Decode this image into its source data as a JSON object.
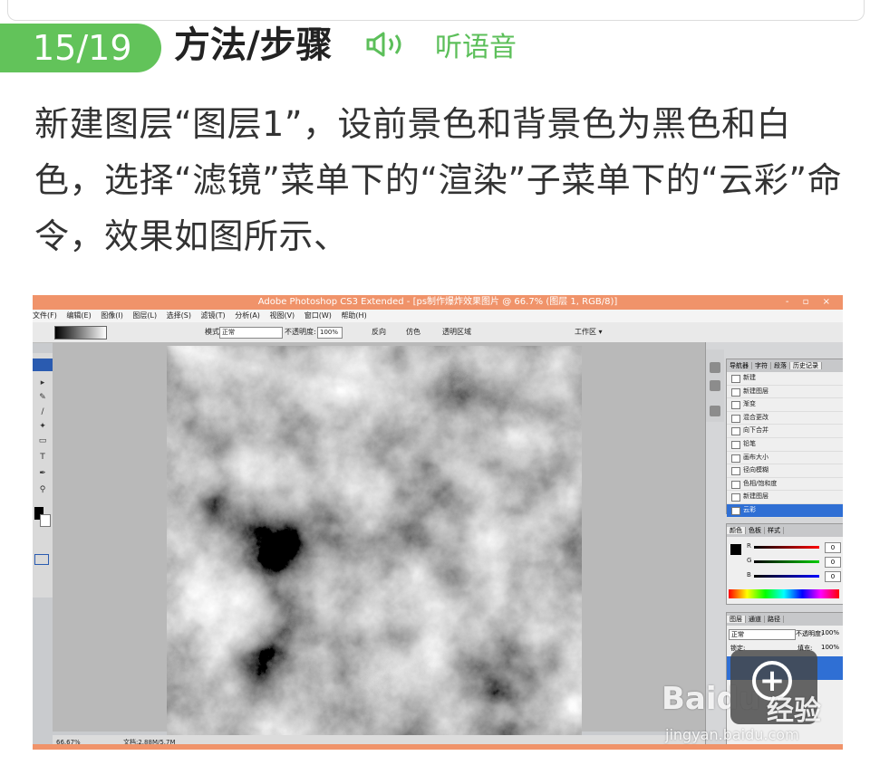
{
  "step": {
    "label": "15/19"
  },
  "header": {
    "title": "方法/步骤",
    "listen_label": "听语音",
    "speaker_icon": "speaker-icon",
    "accent": "#62c35a"
  },
  "body": {
    "text": "新建图层“图层1”，设前景色和背景色为黑色和白色，选择“滤镜”菜单下的“渲染”子菜单下的“云彩”命令，效果如图所示、"
  },
  "screenshot": {
    "window_title": "Adobe Photoshop CS3 Extended - [ps制作爆炸效果图片 @ 66.7% (图层 1, RGB/8)]",
    "window_buttons": "- ▫ ×",
    "menu": [
      "文件(F)",
      "编辑(E)",
      "图像(I)",
      "图层(L)",
      "选择(S)",
      "滤镜(T)",
      "分析(A)",
      "视图(V)",
      "窗口(W)",
      "帮助(H)"
    ],
    "options": {
      "mode_label": "模式:",
      "mode_value": "正常",
      "opacity_label": "不透明度:",
      "opacity_value": "100%",
      "reverse": "反向",
      "dither": "仿色",
      "transparency": "透明区域",
      "workspace": "工作区 ▾"
    },
    "history": {
      "tabs": [
        "导航器",
        "字符",
        "段落",
        "历史记录"
      ],
      "items": [
        "新建",
        "新建图层",
        "渐变",
        "混合更改",
        "向下合并",
        "铅笔",
        "画布大小",
        "径向模糊",
        "色相/饱和度",
        "新建图层",
        "云彩"
      ],
      "selected_index": 10
    },
    "color": {
      "tabs": [
        "颜色",
        "色板",
        "样式"
      ],
      "r_label": "R",
      "g_label": "G",
      "b_label": "B",
      "r_value": "0",
      "g_value": "0",
      "b_value": "0"
    },
    "layers": {
      "tabs": [
        "图层",
        "通道",
        "路径"
      ],
      "mode": "正常",
      "opacity_label": "不透明度:",
      "opacity_value": "100%",
      "lock_label": "锁定:",
      "fill_label": "填充:",
      "fill_value": "100%"
    },
    "status": {
      "zoom": "66.67%",
      "doc": "文档:2.88M/5.7M"
    }
  },
  "watermark": {
    "brand": "Baidu",
    "jingyan": "经验",
    "url": "jingyan.baidu.com"
  }
}
